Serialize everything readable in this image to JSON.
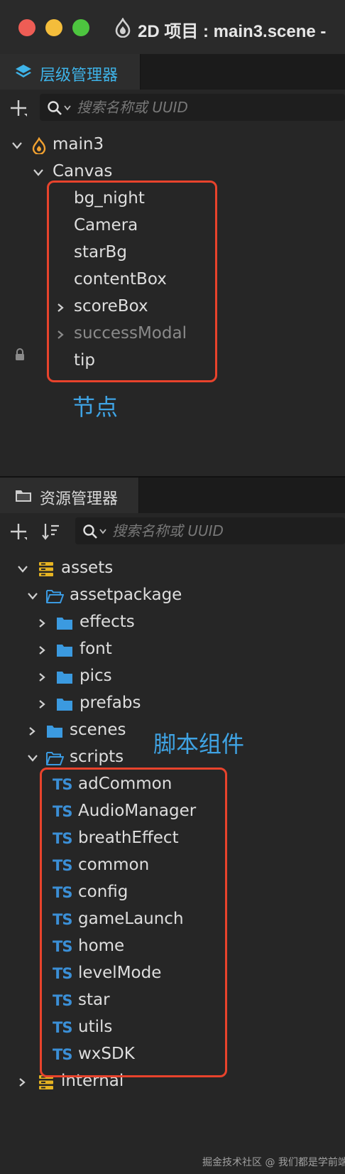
{
  "window": {
    "title": "2D 项目 : main3.scene - "
  },
  "hierarchy": {
    "tab_label": "层级管理器",
    "search_placeholder": "搜索名称或 UUID",
    "root": "main3",
    "canvas": "Canvas",
    "nodes": [
      {
        "label": "bg_night"
      },
      {
        "label": "Camera"
      },
      {
        "label": "starBg"
      },
      {
        "label": "contentBox"
      },
      {
        "label": "scoreBox"
      },
      {
        "label": "successModal"
      },
      {
        "label": "tip"
      }
    ],
    "annotation": "节点"
  },
  "assets": {
    "tab_label": "资源管理器",
    "search_placeholder": "搜索名称或 UUID",
    "root": "assets",
    "assetpackage": "assetpackage",
    "subfolders": [
      {
        "label": "effects"
      },
      {
        "label": "font"
      },
      {
        "label": "pics"
      },
      {
        "label": "prefabs"
      }
    ],
    "scenes": "scenes",
    "scripts": "scripts",
    "ts_badge": "TS",
    "script_files": [
      {
        "label": "adCommon"
      },
      {
        "label": "AudioManager"
      },
      {
        "label": "breathEffect"
      },
      {
        "label": "common"
      },
      {
        "label": "config"
      },
      {
        "label": "gameLaunch"
      },
      {
        "label": "home"
      },
      {
        "label": "levelMode"
      },
      {
        "label": "star"
      },
      {
        "label": "utils"
      },
      {
        "label": "wxSDK"
      }
    ],
    "internal": "internal",
    "annotation": "脚本组件"
  },
  "watermark": "掘金技术社区 @ 我们都是学前端",
  "colors": {
    "accent": "#3eb3e8",
    "annotation_box": "#e8432c",
    "annotation_text": "#3fa3e3",
    "folder": "#3b9ae0",
    "db_icon": "#e6b422",
    "ts_badge": "#3b8fd6"
  },
  "icons": {
    "hierarchy_tab": "layers-icon",
    "assets_tab": "folder-icon",
    "root_node": "flame-icon",
    "lock": "lock-icon"
  }
}
